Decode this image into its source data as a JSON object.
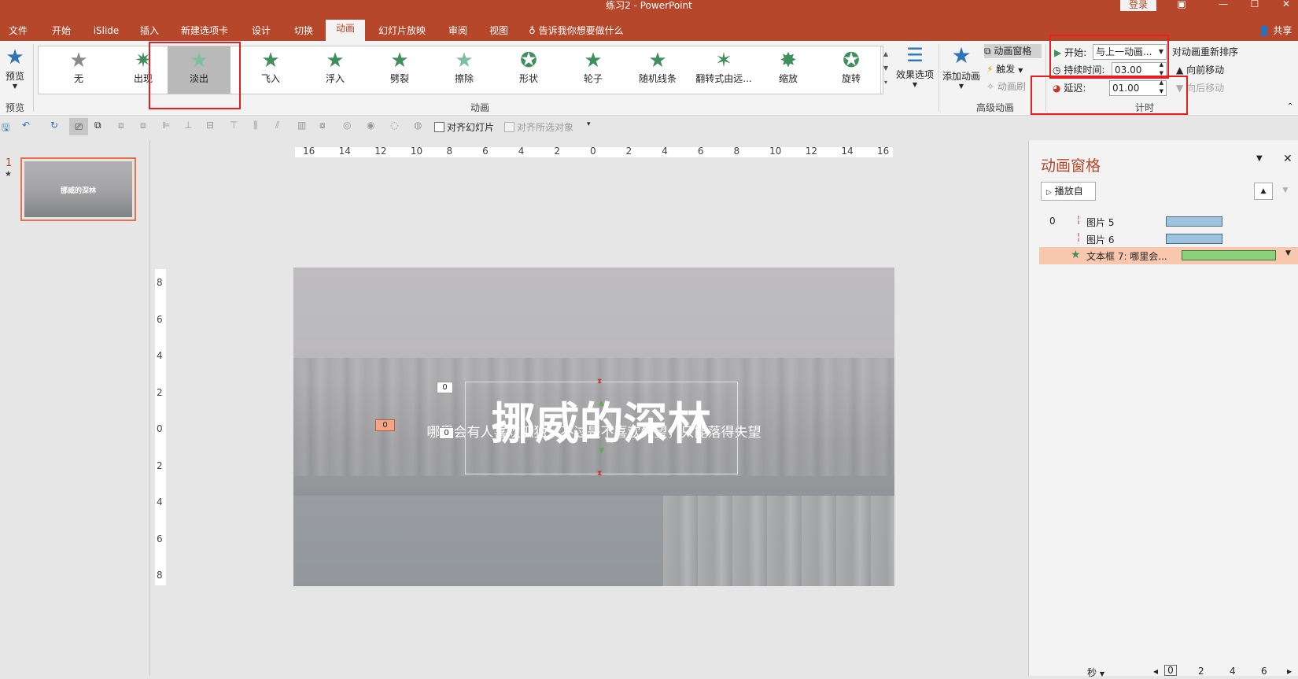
{
  "window": {
    "title": "练习2 - PowerPoint",
    "login": "登录"
  },
  "tabs": [
    "文件",
    "开始",
    "iSlide",
    "插入",
    "新建选项卡",
    "设计",
    "切换",
    "动画",
    "幻灯片放映",
    "审阅",
    "视图"
  ],
  "tell_me": "告诉我你想要做什么",
  "share": "共享",
  "ribbon": {
    "preview": {
      "label": "预览",
      "group": "预览"
    },
    "animations": [
      "无",
      "出现",
      "淡出",
      "飞入",
      "浮入",
      "劈裂",
      "擦除",
      "形状",
      "轮子",
      "随机线条",
      "翻转式由远...",
      "缩放",
      "旋转"
    ],
    "selected_animation": "淡出",
    "effect_options": "效果选项",
    "animation_group": "动画",
    "add_animation": "添加动画",
    "animation_pane_btn": "动画窗格",
    "trigger": "触发",
    "painter": "动画刷",
    "advanced_group": "高级动画",
    "start_label": "开始:",
    "start_value": "与上一动画...",
    "duration_label": "持续时间:",
    "duration_value": "03.00",
    "delay_label": "延迟:",
    "delay_value": "01.00",
    "reorder_title": "对动画重新排序",
    "move_earlier": "向前移动",
    "move_later": "向后移动",
    "timing_group": "计时"
  },
  "qat": {
    "align_slide": "对齐幻灯片",
    "align_selected": "对齐所选对象"
  },
  "thumb": {
    "number": "1",
    "star": "★",
    "title": "挪威的深林"
  },
  "ruler": {
    "h": [
      "16",
      "14",
      "12",
      "10",
      "8",
      "6",
      "4",
      "2",
      "0",
      "2",
      "4",
      "6",
      "8",
      "10",
      "12",
      "14",
      "16"
    ],
    "v": [
      "8",
      "6",
      "4",
      "2",
      "0",
      "2",
      "4",
      "6",
      "8"
    ]
  },
  "slide": {
    "title": "挪威的深林",
    "subtitle": "哪里会有人喜欢孤独，不过是不喜欢失望，只能落得失望",
    "tag_a": "0",
    "tag_b": "0",
    "tag_c": "0"
  },
  "pane": {
    "title": "动画窗格",
    "play_from": "播放自",
    "items": [
      {
        "index": "0",
        "name": "图片 5",
        "start": 0.0,
        "end": 0.6
      },
      {
        "index": "",
        "name": "图片 6",
        "start": 0.0,
        "end": 0.6
      },
      {
        "index": "",
        "name": "文本框 7: 哪里会...",
        "start": 0.0,
        "end": 1.0
      }
    ],
    "seconds_label": "秒",
    "scale": [
      "0",
      "2",
      "4",
      "6"
    ]
  },
  "colors": {
    "accent": "#b7472a",
    "green_star": "#3f8f5c",
    "blue_bar": "#9fc3dd",
    "green_bar": "#8fd17a",
    "highlight": "#f9c7ad",
    "red_box": "#e81e1e"
  }
}
